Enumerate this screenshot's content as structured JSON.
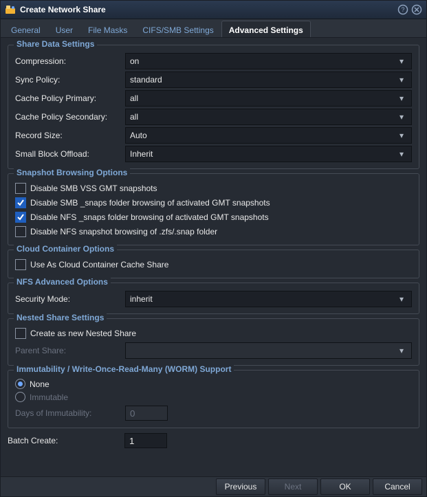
{
  "title": "Create Network Share",
  "tabs": [
    "General",
    "User",
    "File Masks",
    "CIFS/SMB Settings",
    "Advanced Settings"
  ],
  "activeTab": 4,
  "shareData": {
    "legend": "Share Data Settings",
    "compression": {
      "label": "Compression:",
      "value": "on"
    },
    "syncPolicy": {
      "label": "Sync Policy:",
      "value": "standard"
    },
    "cachePrimary": {
      "label": "Cache Policy Primary:",
      "value": "all"
    },
    "cacheSecondary": {
      "label": "Cache Policy Secondary:",
      "value": "all"
    },
    "recordSize": {
      "label": "Record Size:",
      "value": "Auto"
    },
    "smallBlock": {
      "label": "Small Block Offload:",
      "value": "Inherit"
    }
  },
  "snapshot": {
    "legend": "Snapshot Browsing Options",
    "opts": [
      {
        "label": "Disable SMB VSS GMT snapshots",
        "checked": false
      },
      {
        "label": "Disable SMB _snaps folder browsing of activated GMT snapshots",
        "checked": true
      },
      {
        "label": "Disable NFS _snaps folder browsing of activated GMT snapshots",
        "checked": true
      },
      {
        "label": "Disable NFS snapshot browsing of .zfs/.snap folder",
        "checked": false
      }
    ]
  },
  "cloud": {
    "legend": "Cloud Container Options",
    "opt": {
      "label": "Use As Cloud Container Cache Share",
      "checked": false
    }
  },
  "nfs": {
    "legend": "NFS Advanced Options",
    "securityMode": {
      "label": "Security Mode:",
      "value": "inherit"
    }
  },
  "nested": {
    "legend": "Nested Share Settings",
    "createNew": {
      "label": "Create as new Nested Share",
      "checked": false
    },
    "parent": {
      "label": "Parent Share:",
      "value": "",
      "disabled": true
    }
  },
  "worm": {
    "legend": "Immutability / Write-Once-Read-Many (WORM) Support",
    "none": "None",
    "immutable": "Immutable",
    "selected": "none",
    "days": {
      "label": "Days of Immutability:",
      "value": "0",
      "disabled": true
    }
  },
  "batch": {
    "label": "Batch Create:",
    "value": "1"
  },
  "buttons": {
    "previous": "Previous",
    "next": "Next",
    "ok": "OK",
    "cancel": "Cancel"
  }
}
